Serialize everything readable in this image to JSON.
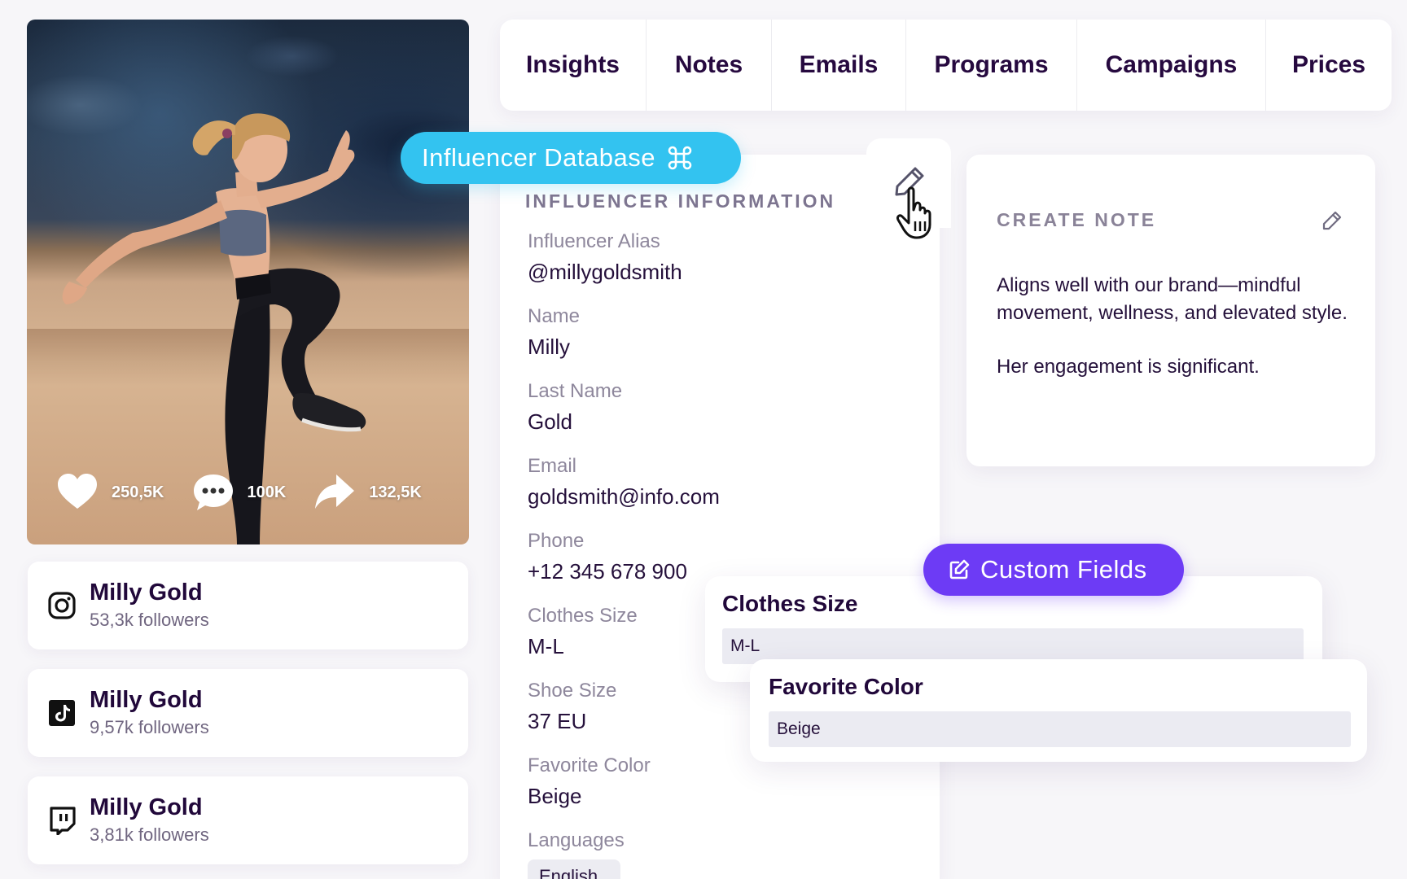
{
  "photo": {
    "likes": "250,5K",
    "comments": "100K",
    "shares": "132,5K"
  },
  "socials": [
    {
      "network": "instagram-icon",
      "name": "Milly Gold",
      "followers": "53,3k followers"
    },
    {
      "network": "tiktok-icon",
      "name": "Milly Gold",
      "followers": "9,57k followers"
    },
    {
      "network": "twitch-icon",
      "name": "Milly Gold",
      "followers": "3,81k followers"
    }
  ],
  "tabs": [
    "Insights",
    "Notes",
    "Emails",
    "Programs",
    "Campaigns",
    "Prices"
  ],
  "badges": {
    "database": "Influencer Database",
    "custom_fields": "Custom Fields"
  },
  "info": {
    "title": "INFLUENCER INFORMATION",
    "fields": [
      {
        "label": "Influencer Alias",
        "value": "@millygoldsmith"
      },
      {
        "label": "Name",
        "value": "Milly"
      },
      {
        "label": "Last Name",
        "value": "Gold"
      },
      {
        "label": "Email",
        "value": "goldsmith@info.com"
      },
      {
        "label": "Phone",
        "value": "+12 345 678 900"
      },
      {
        "label": "Clothes Size",
        "value": "M-L"
      },
      {
        "label": "Shoe Size",
        "value": "37 EU"
      },
      {
        "label": "Favorite Color",
        "value": "Beige"
      },
      {
        "label": "Languages",
        "value": "English"
      }
    ]
  },
  "note": {
    "title": "CREATE NOTE",
    "paragraphs": [
      "Aligns well with our brand—mindful movement, wellness, and elevated style.",
      "Her engagement is significant."
    ]
  },
  "custom_fields": [
    {
      "label": "Clothes Size",
      "value": "M-L"
    },
    {
      "label": "Favorite Color",
      "value": "Beige"
    }
  ],
  "colors": {
    "database_pill": "#33c3f0",
    "custom_fields_pill": "#6d3bf5",
    "text_dark": "#21083a"
  }
}
